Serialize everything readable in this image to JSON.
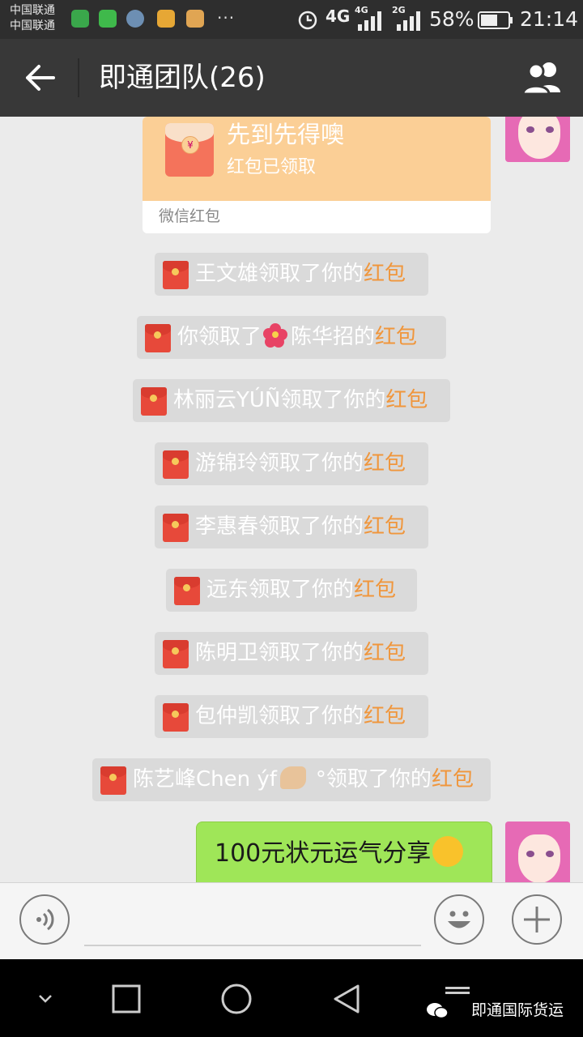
{
  "status_bar": {
    "carrier_1": "中国联通",
    "carrier_2": "中国联通",
    "more": "···",
    "network_1": "4G",
    "network_2": "4G",
    "network_3": "2G",
    "battery_percent": "58%",
    "time": "21:14"
  },
  "header": {
    "title": "即通团队(26)"
  },
  "red_packet_card": {
    "title": "先到先得噢",
    "status": "红包已领取",
    "footer": "微信红包"
  },
  "system_messages": [
    {
      "before": "王文雄领取了你的",
      "highlight": "红包"
    },
    {
      "before": "你领取了",
      "after_emoji": "陈华招的",
      "highlight": "红包"
    },
    {
      "before": "林丽云YÚÑ领取了你的",
      "highlight": "红包"
    },
    {
      "before": "游锦玲领取了你的",
      "highlight": "红包"
    },
    {
      "before": "李惠春领取了你的",
      "highlight": "红包"
    },
    {
      "before": "远东领取了你的",
      "highlight": "红包"
    },
    {
      "before": "陈明卫领取了你的",
      "highlight": "红包"
    },
    {
      "before": "包仲凯领取了你的",
      "highlight": "红包"
    },
    {
      "before": "陈艺峰Chen ýf",
      "after_emoji": "°领取了你的",
      "highlight": "红包"
    }
  ],
  "outgoing_message": {
    "text": "100元状元运气分享"
  },
  "watermark": {
    "text": "即通国际货运"
  },
  "colors": {
    "status_bar": "#2e2e2e",
    "title_bar": "#383838",
    "chat_bg": "#ebebeb",
    "red_packet": "#fbcf96",
    "highlight": "#f0963c",
    "outgoing_bubble": "#9fe658"
  }
}
